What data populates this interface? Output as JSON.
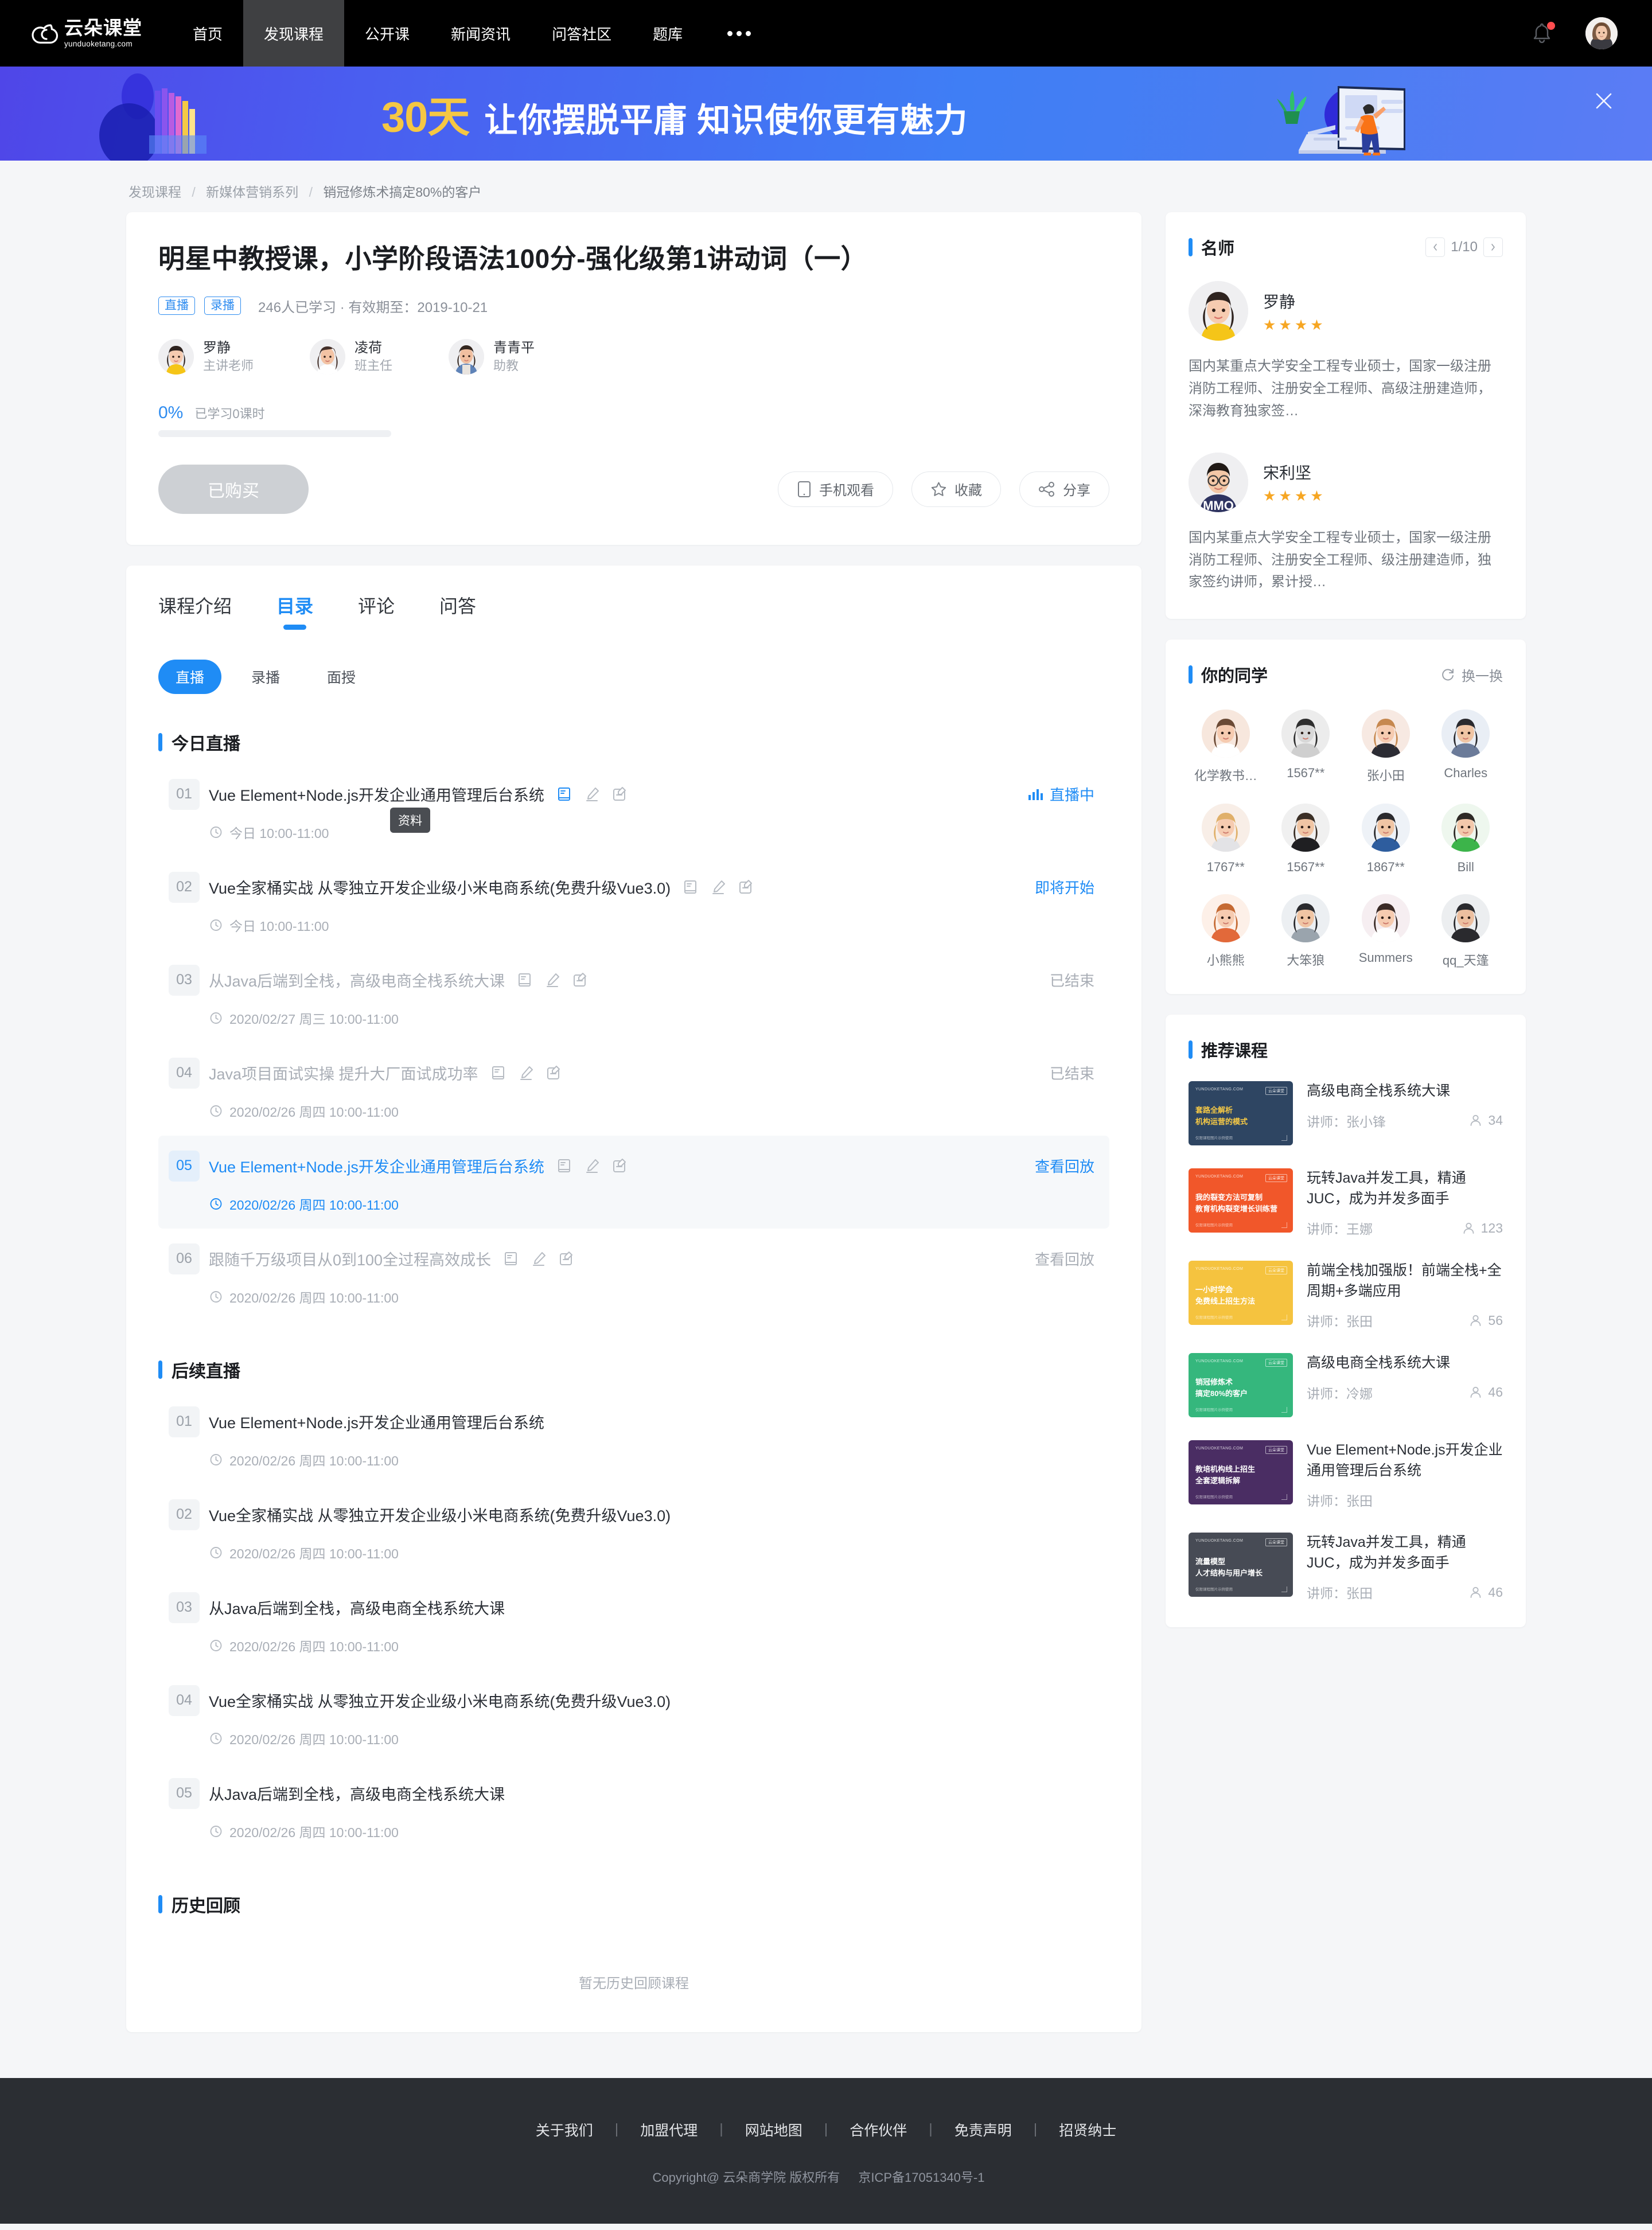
{
  "header": {
    "logo_cn": "云朵课堂",
    "logo_en": "yunduoketang.com",
    "nav": [
      {
        "label": "首页",
        "active": false
      },
      {
        "label": "发现课程",
        "active": true
      },
      {
        "label": "公开课",
        "active": false
      },
      {
        "label": "新闻资讯",
        "active": false
      },
      {
        "label": "问答社区",
        "active": false
      },
      {
        "label": "题库",
        "active": false
      }
    ],
    "more_label": "更多",
    "bell_icon": "bell-icon",
    "avatar_icon": "user-avatar"
  },
  "banner": {
    "highlight": "30天",
    "message": "让你摆脱平庸  知识使你更有魅力",
    "close_icon": "close-icon"
  },
  "breadcrumb": {
    "items": [
      "发现课程",
      "新媒体营销系列",
      "销冠修炼术搞定80%的客户"
    ],
    "separator": "/"
  },
  "course": {
    "title": "明星中教授课，小学阶段语法100分-强化级第1讲动词（一）",
    "tags": [
      "直播",
      "录播"
    ],
    "meta": "246人已学习 · 有效期至：2019-10-21",
    "teachers": [
      {
        "name": "罗静",
        "role": "主讲老师"
      },
      {
        "name": "凌荷",
        "role": "班主任"
      },
      {
        "name": "青青平",
        "role": "助教"
      }
    ],
    "progress_percent": "0%",
    "progress_value": 0,
    "progress_label": "已学习0课时",
    "buy_button": "已购买",
    "actions": [
      {
        "label": "手机观看",
        "icon": "mobile-icon"
      },
      {
        "label": "收藏",
        "icon": "star-icon"
      },
      {
        "label": "分享",
        "icon": "share-icon"
      }
    ]
  },
  "tabs": [
    {
      "label": "课程介绍",
      "active": false
    },
    {
      "label": "目录",
      "active": true
    },
    {
      "label": "评论",
      "active": false
    },
    {
      "label": "问答",
      "active": false
    }
  ],
  "subtabs": [
    {
      "label": "直播",
      "active": true
    },
    {
      "label": "录播",
      "active": false
    },
    {
      "label": "面授",
      "active": false
    }
  ],
  "catalog": {
    "today_title": "今日直播",
    "today": [
      {
        "no": "01",
        "name": "Vue Element+Node.js开发企业通用管理后台系统",
        "time": "今日 10:00-11:00",
        "status": "直播中",
        "status_type": "live",
        "icons": [
          "material-icon",
          "homework-icon",
          "exam-icon"
        ],
        "tooltip": "资料",
        "highlight": false,
        "dim": false
      },
      {
        "no": "02",
        "name": "Vue全家桶实战 从零独立开发企业级小米电商系统(免费升级Vue3.0)",
        "time": "今日 10:00-11:00",
        "status": "即将开始",
        "status_type": "soon",
        "icons": [
          "material-icon",
          "homework-icon",
          "exam-icon"
        ],
        "highlight": false,
        "dim": false
      },
      {
        "no": "03",
        "name": "从Java后端到全栈，高级电商全栈系统大课",
        "time": "2020/02/27 周三 10:00-11:00",
        "status": "已结束",
        "status_type": "end",
        "icons": [
          "material-icon",
          "homework-icon",
          "exam-icon"
        ],
        "highlight": false,
        "dim": true
      },
      {
        "no": "04",
        "name": "Java项目面试实操 提升大厂面试成功率",
        "time": "2020/02/26 周四 10:00-11:00",
        "status": "已结束",
        "status_type": "end",
        "icons": [
          "material-icon",
          "homework-icon",
          "exam-icon"
        ],
        "highlight": false,
        "dim": true
      },
      {
        "no": "05",
        "name": "Vue Element+Node.js开发企业通用管理后台系统",
        "time": "2020/02/26 周四 10:00-11:00",
        "status": "查看回放",
        "status_type": "replay",
        "icons": [
          "material-icon",
          "homework-icon",
          "exam-icon"
        ],
        "highlight": true,
        "dim": false
      },
      {
        "no": "06",
        "name": "跟随千万级项目从0到100全过程高效成长",
        "time": "2020/02/26 周四 10:00-11:00",
        "status": "查看回放",
        "status_type": "replay-dim",
        "icons": [
          "material-icon",
          "homework-icon",
          "exam-icon"
        ],
        "highlight": false,
        "dim": true
      }
    ],
    "upcoming_title": "后续直播",
    "upcoming": [
      {
        "no": "01",
        "name": "Vue Element+Node.js开发企业通用管理后台系统",
        "time": "2020/02/26 周四 10:00-11:00"
      },
      {
        "no": "02",
        "name": "Vue全家桶实战 从零独立开发企业级小米电商系统(免费升级Vue3.0)",
        "time": "2020/02/26 周四 10:00-11:00"
      },
      {
        "no": "03",
        "name": "从Java后端到全栈，高级电商全栈系统大课",
        "time": "2020/02/26 周四 10:00-11:00"
      },
      {
        "no": "04",
        "name": "Vue全家桶实战 从零独立开发企业级小米电商系统(免费升级Vue3.0)",
        "time": "2020/02/26 周四 10:00-11:00"
      },
      {
        "no": "05",
        "name": "从Java后端到全栈，高级电商全栈系统大课",
        "time": "2020/02/26 周四 10:00-11:00"
      }
    ],
    "history_title": "历史回顾",
    "history_empty": "暂无历史回顾课程"
  },
  "sidebar": {
    "teachers_panel": {
      "title": "名师",
      "page_text": "1/10",
      "prev_icon": "chevron-left-icon",
      "next_icon": "chevron-right-icon",
      "items": [
        {
          "name": "罗静",
          "stars": 4,
          "desc": "国内某重点大学安全工程专业硕士，国家一级注册消防工程师、注册安全工程师、高级注册建造师，深海教育独家签…"
        },
        {
          "name": "宋利坚",
          "stars": 4,
          "desc": "国内某重点大学安全工程专业硕士，国家一级注册消防工程师、注册安全工程师、级注册建造师，独家签约讲师，累计授…"
        }
      ]
    },
    "classmates_panel": {
      "title": "你的同学",
      "refresh_label": "换一换",
      "refresh_icon": "refresh-icon",
      "items": [
        {
          "name": "化学教书…"
        },
        {
          "name": "1567**"
        },
        {
          "name": "张小田"
        },
        {
          "name": "Charles"
        },
        {
          "name": "1767**"
        },
        {
          "name": "1567**"
        },
        {
          "name": "1867**"
        },
        {
          "name": "Bill"
        },
        {
          "name": "小熊熊"
        },
        {
          "name": "大笨狼"
        },
        {
          "name": "Summers"
        },
        {
          "name": "qq_天篷"
        }
      ]
    },
    "recommend_panel": {
      "title": "推荐课程",
      "items": [
        {
          "title": "高级电商全栈系统大课",
          "teacher_label": "讲师：张小锋",
          "count": "34",
          "thumb_color": "#2e4562",
          "thumb_l1": "套路全解析",
          "thumb_l2": "机构运营的模式",
          "thumb_accent": "amber"
        },
        {
          "title": "玩转Java并发工具，精通JUC，成为并发多面手",
          "teacher_label": "讲师：王娜",
          "count": "123",
          "thumb_color": "#f1572a",
          "thumb_l1": "我的裂变方法可复制",
          "thumb_l2": "教育机构裂变增长训练营",
          "thumb_accent": "white"
        },
        {
          "title": "前端全栈加强版！前端全栈+全周期+多端应用",
          "teacher_label": "讲师：张田",
          "count": "56",
          "thumb_color": "#f5c33f",
          "thumb_l1": "一小时学会",
          "thumb_l2": "免费线上招生方法",
          "thumb_accent": "white"
        },
        {
          "title": "高级电商全栈系统大课",
          "teacher_label": "讲师：冷娜",
          "count": "46",
          "thumb_color": "#35b77d",
          "thumb_l1": "销冠修炼术",
          "thumb_l2": "搞定80%的客户",
          "thumb_accent": "white"
        },
        {
          "title": "Vue Element+Node.js开发企业通用管理后台系统",
          "teacher_label": "讲师：张田",
          "count": "",
          "thumb_color": "#4a2d63",
          "thumb_l1": "教培机构线上招生",
          "thumb_l2": "全套逻辑拆解",
          "thumb_accent": "white"
        },
        {
          "title": "玩转Java并发工具，精通JUC，成为并发多面手",
          "teacher_label": "讲师：张田",
          "count": "46",
          "thumb_color": "#474b55",
          "thumb_l1": "流量模型",
          "thumb_l2": "人才结构与用户增长",
          "thumb_accent": "white"
        }
      ]
    }
  },
  "footer": {
    "links": [
      "关于我们",
      "加盟代理",
      "网站地图",
      "合作伙伴",
      "免责声明",
      "招贤纳士"
    ],
    "copyright": "Copyright@ 云朵商学院   版权所有",
    "icp": "京ICP备17051340号-1"
  },
  "colors": {
    "accent": "#1f8cf5",
    "tag_blue": "#2e8cf0",
    "star_orange": "#f6a623",
    "nav_bg": "#000000",
    "footer_bg": "#2b2e33"
  }
}
